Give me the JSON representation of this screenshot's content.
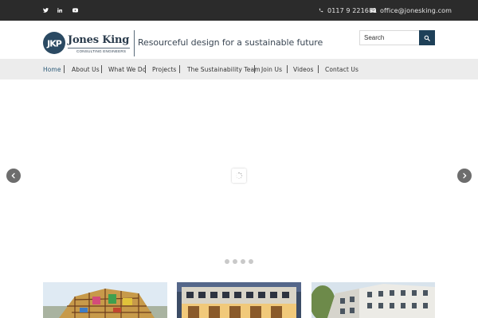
{
  "topbar": {
    "social": [
      {
        "name": "twitter-icon"
      },
      {
        "name": "linkedin-icon"
      },
      {
        "name": "youtube-icon"
      }
    ],
    "phone": "0117 9 221681",
    "email": "office@jonesking.com"
  },
  "header": {
    "logo_initials": "JKP",
    "logo_name": "Jones King",
    "logo_sub": "CONSULTING ENGINEERS",
    "tagline": "Resourceful design for a sustainable future",
    "search_placeholder": "Search"
  },
  "nav": {
    "items": [
      {
        "label": "Home",
        "active": true
      },
      {
        "label": "About Us"
      },
      {
        "label": "What We Do"
      },
      {
        "label": "Projects"
      },
      {
        "label": "The Sustainability Team"
      },
      {
        "label": "Join Us"
      },
      {
        "label": "Videos"
      },
      {
        "label": "Contact Us"
      }
    ]
  },
  "slider": {
    "dots": 4,
    "prev_icon": "chevron-left-icon",
    "next_icon": "chevron-right-icon",
    "loader_icon": "spinner-icon"
  },
  "colors": {
    "topbar_bg": "#2b2b2b",
    "brand_navy": "#1e4058",
    "nav_bg": "#ececec",
    "active_link": "#2b5a78"
  }
}
